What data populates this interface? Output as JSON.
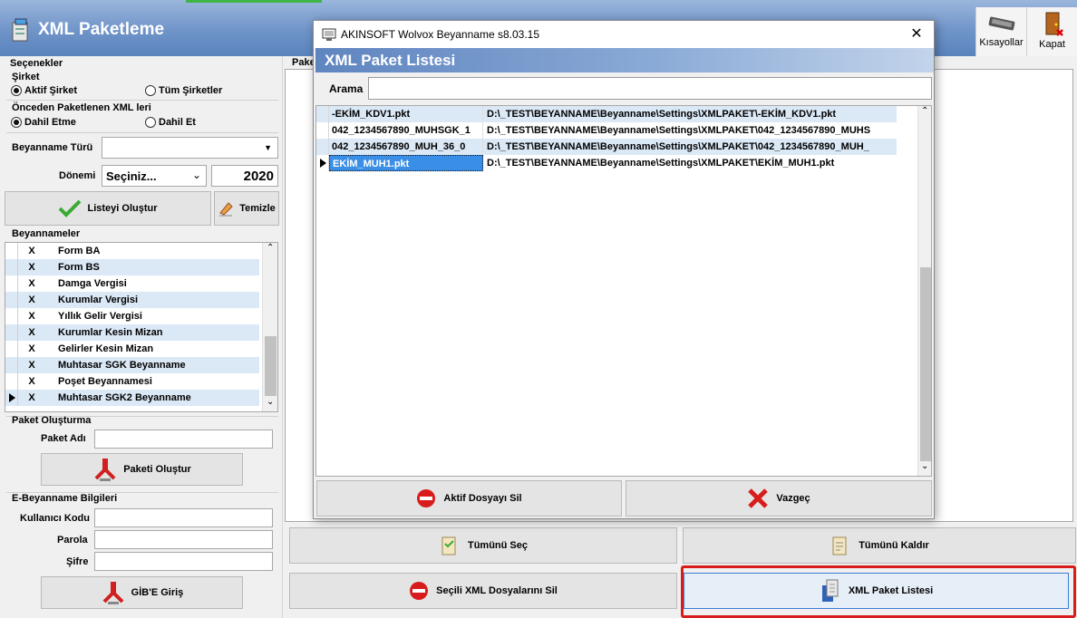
{
  "app": {
    "title": "XML Paketleme",
    "toolbar": {
      "shortcuts_label": "Kısayollar",
      "close_label": "Kapat"
    }
  },
  "left": {
    "options_header": "Seçenekler",
    "company_label": "Şirket",
    "active_company": "Aktif Şirket",
    "all_companies": "Tüm Şirketler",
    "prev_packaged_label": "Önceden Paketlenen XML leri",
    "include": "Dahil Etme",
    "exclude": "Dahil Et",
    "type_label": "Beyanname Türü",
    "period_label": "Dönemi",
    "period_value": "Seçiniz...",
    "year_value": "2020",
    "create_list_button": "Listeyi Oluştur",
    "clear_button": "Temizle",
    "declarations_header": "Beyannameler",
    "declarations": [
      {
        "mark": "X",
        "name": "Form BA"
      },
      {
        "mark": "X",
        "name": "Form BS"
      },
      {
        "mark": "X",
        "name": "Damga Vergisi"
      },
      {
        "mark": "X",
        "name": "Kurumlar Vergisi"
      },
      {
        "mark": "X",
        "name": "Yıllık Gelir Vergisi"
      },
      {
        "mark": "X",
        "name": "Kurumlar Kesin Mizan"
      },
      {
        "mark": "X",
        "name": "Gelirler Kesin Mizan"
      },
      {
        "mark": "X",
        "name": "Muhtasar SGK  Beyanname"
      },
      {
        "mark": "X",
        "name": "Poşet Beyannamesi"
      },
      {
        "mark": "X",
        "name": "Muhtasar SGK2  Beyanname"
      }
    ],
    "package_header": "Paket Oluşturma",
    "package_name_label": "Paket Adı",
    "create_package_button": "Paketi Oluştur",
    "ebey_header": "E-Beyanname Bilgileri",
    "username_label": "Kullanıcı Kodu",
    "password_label": "Parola",
    "cipher_label": "Şifre",
    "gib_login_button": "GİB'E Giriş"
  },
  "right": {
    "panel_title_fragment": "Pake",
    "select_all_button": "Tümünü Seç",
    "deselect_all_button": "Tümünü Kaldır",
    "delete_selected_button": "Seçili XML Dosyalarını Sil",
    "xml_list_button": "XML Paket Listesi"
  },
  "modal": {
    "window_title": "AKINSOFT Wolvox Beyanname s8.03.15",
    "close_glyph": "✕",
    "banner_title": "XML Paket Listesi",
    "search_label": "Arama",
    "search_value": "",
    "files": [
      {
        "name": "-EKİM_KDV1.pkt",
        "path": "D:\\_TEST\\BEYANNAME\\Beyanname\\Settings\\XMLPAKET\\-EKİM_KDV1.pkt"
      },
      {
        "name": "042_1234567890_MUHSGK_1",
        "path": "D:\\_TEST\\BEYANNAME\\Beyanname\\Settings\\XMLPAKET\\042_1234567890_MUHS"
      },
      {
        "name": "042_1234567890_MUH_36_0",
        "path": "D:\\_TEST\\BEYANNAME\\Beyanname\\Settings\\XMLPAKET\\042_1234567890_MUH_"
      },
      {
        "name": "EKİM_MUH1.pkt",
        "path": "D:\\_TEST\\BEYANNAME\\Beyanname\\Settings\\XMLPAKET\\EKİM_MUH1.pkt"
      }
    ],
    "delete_active_button": "Aktif Dosyayı Sil",
    "cancel_button": "Vazgeç"
  }
}
